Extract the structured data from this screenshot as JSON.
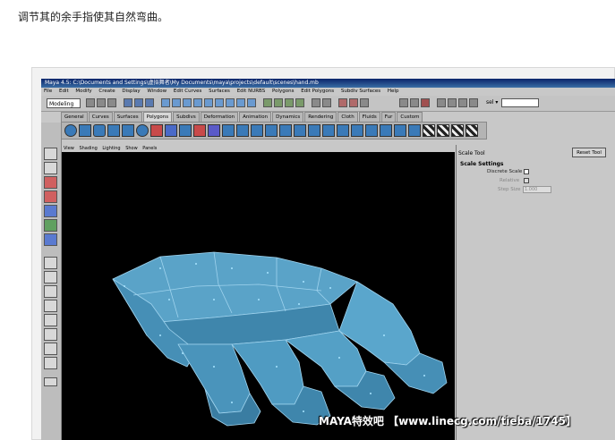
{
  "caption": "调节其的余手指使其自然弯曲。",
  "window": {
    "title": "Maya 4.5: C:\\Documents and Settings\\虚拟舞者\\My Documents\\maya\\projects\\default\\scenes\\hand.mb"
  },
  "menubar": [
    "File",
    "Edit",
    "Modify",
    "Create",
    "Display",
    "Window",
    "Edit Curves",
    "Surfaces",
    "Edit NURBS",
    "Polygons",
    "Edit Polygons",
    "Subdiv Surfaces",
    "Help"
  ],
  "statusline": {
    "mode": "Modeling",
    "sel_label": "sel ▾"
  },
  "shelf_tabs": [
    "General",
    "Curves",
    "Surfaces",
    "Polygons",
    "Subdivs",
    "Deformation",
    "Animation",
    "Dynamics",
    "Rendering",
    "Cloth",
    "Fluids",
    "Fur",
    "Custom"
  ],
  "viewport_menu": [
    "View",
    "Shading",
    "Lighting",
    "Show",
    "Panels"
  ],
  "attr_panel": {
    "title": "Scale Tool",
    "reset_label": "Reset Tool",
    "section": "Scale Settings",
    "discrete_label": "Discrete Scale",
    "relative_label": "Relative",
    "step_size_label": "Step Size",
    "step_size_value": "1.000"
  },
  "watermark": "MAYA特效吧 【www.linecg.com/tieba/1745】",
  "colors": {
    "mesh": "#4f9bc2",
    "mesh_dark": "#2f6f92",
    "viewport_bg": "#000000",
    "title_bar": "#0a246a"
  }
}
